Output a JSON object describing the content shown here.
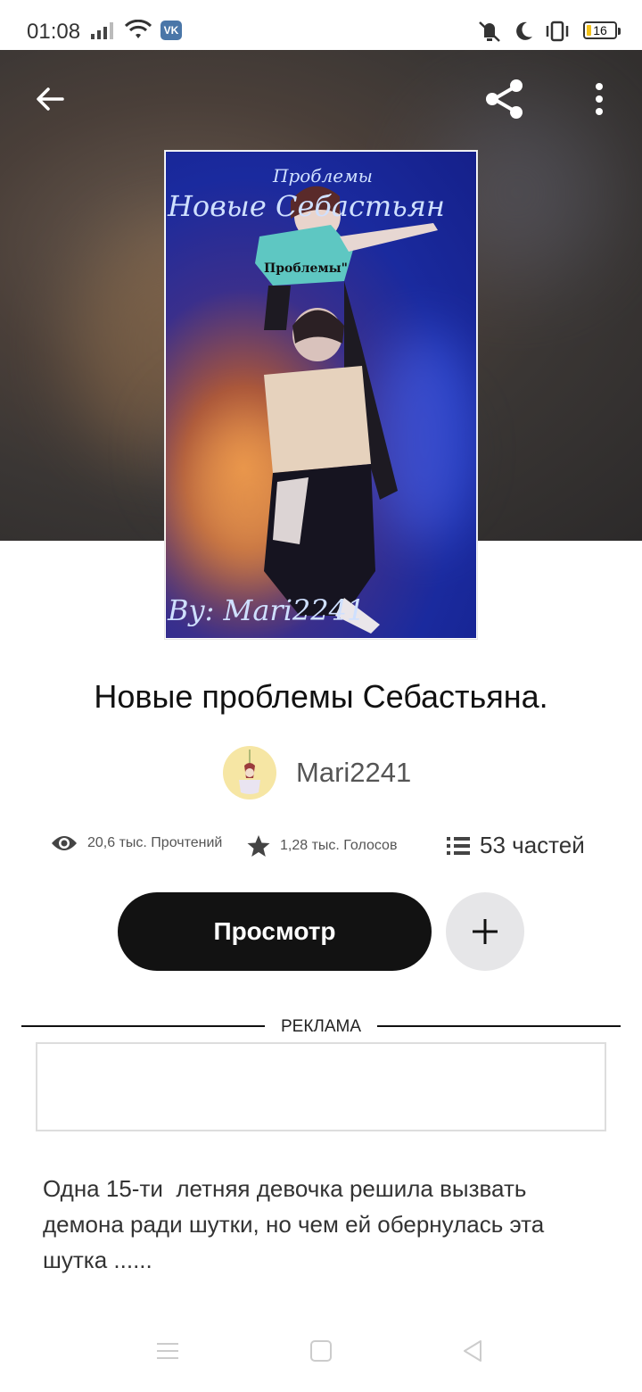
{
  "status_bar": {
    "time": "01:08",
    "vk_label": "VK",
    "battery_level": "16",
    "battery_fraction": 0.16
  },
  "header": {
    "back_icon": "arrow-left-icon",
    "share_icon": "share-icon",
    "menu_icon": "more-vertical-icon"
  },
  "book": {
    "title": "Новые проблемы Себастьяна.",
    "author": "Mari2241",
    "reads": "20,6 тыс. Прочтений",
    "votes": "1,28 тыс. Голосов",
    "parts": "53 частей",
    "description": "Одна 15-ти  летняя девочка решила вызвать демона ради шутки, но чем ей обернулась эта шутка ......"
  },
  "cover_text": {
    "line1": "Проблемы",
    "line2": "Новые Себастьян",
    "line3": "Проблемы\"",
    "signature": "By: Mari2241"
  },
  "actions": {
    "view_label": "Просмотр",
    "add_icon": "plus-icon"
  },
  "ad": {
    "label": "РЕКЛАМА"
  },
  "colors": {
    "primary_button": "#121212",
    "secondary_button": "#e6e6e8",
    "battery": "#f3c21a"
  }
}
